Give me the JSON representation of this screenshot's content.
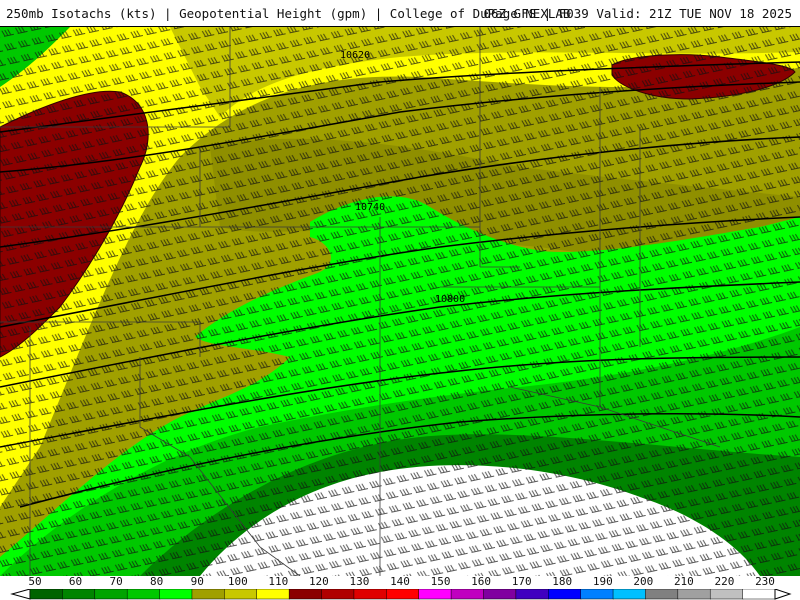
{
  "header": {
    "title_left": "250mb Isotachs (kts) | Geopotential Height (gpm) | College of DuPage NEXLAB",
    "title_right": "06Z GFS | F039 Valid: 21Z TUE NOV 18 2025"
  },
  "map": {
    "contour_labels": [
      "10620",
      "10740",
      "10800"
    ]
  },
  "legend": {
    "labels": [
      "50",
      "60",
      "70",
      "80",
      "90",
      "100",
      "110",
      "120",
      "130",
      "140",
      "150",
      "160",
      "170",
      "180",
      "190",
      "200",
      "210",
      "220",
      "230"
    ],
    "colors": [
      "#006400",
      "#008400",
      "#00a400",
      "#00c800",
      "#00ff00",
      "#a0a000",
      "#c8c800",
      "#ffff00",
      "#8b0000",
      "#b00000",
      "#e00000",
      "#ff0000",
      "#ff00ff",
      "#c000c0",
      "#8000a0",
      "#4000c0",
      "#0000ff",
      "#0080ff",
      "#00c0ff",
      "#808080",
      "#a0a0a0",
      "#c0c0c0",
      "#ffffff"
    ]
  }
}
